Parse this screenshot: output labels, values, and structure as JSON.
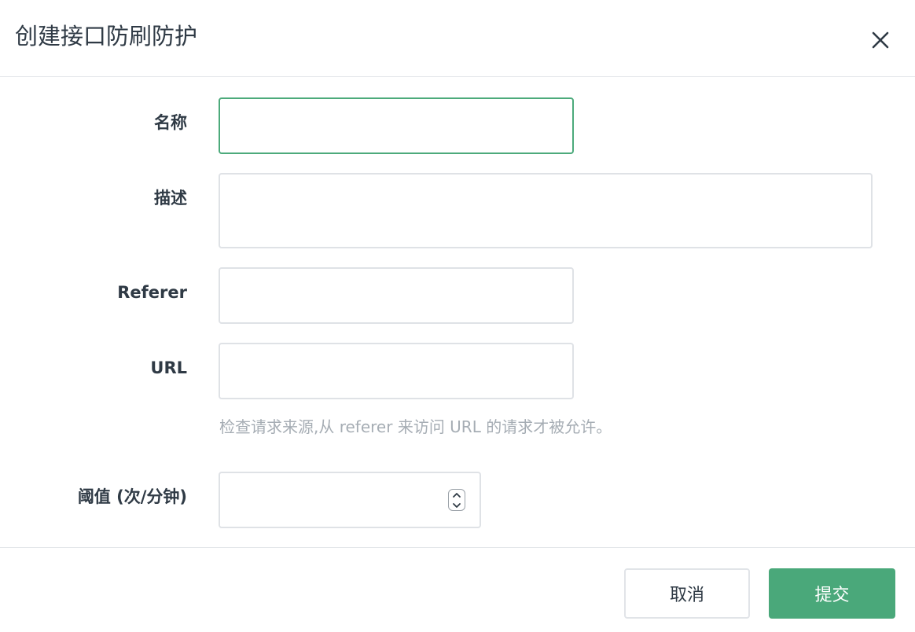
{
  "dialog": {
    "title": "创建接口防刷防护",
    "close_icon": "close-icon"
  },
  "form": {
    "name": {
      "label": "名称",
      "value": "",
      "placeholder": ""
    },
    "description": {
      "label": "描述",
      "value": "",
      "placeholder": ""
    },
    "referer": {
      "label": "Referer",
      "value": "",
      "placeholder": ""
    },
    "url": {
      "label": "URL",
      "value": "",
      "placeholder": "",
      "help": "检查请求来源,从 referer 来访问 URL 的请求才被允许。"
    },
    "threshold": {
      "label": "阈值 (次/分钟)",
      "value": "",
      "placeholder": ""
    }
  },
  "footer": {
    "cancel_label": "取消",
    "submit_label": "提交"
  },
  "colors": {
    "accent": "#4aa87a",
    "focus_border": "#4caa7b",
    "text": "#2f3a45",
    "muted": "#a6adb4"
  }
}
